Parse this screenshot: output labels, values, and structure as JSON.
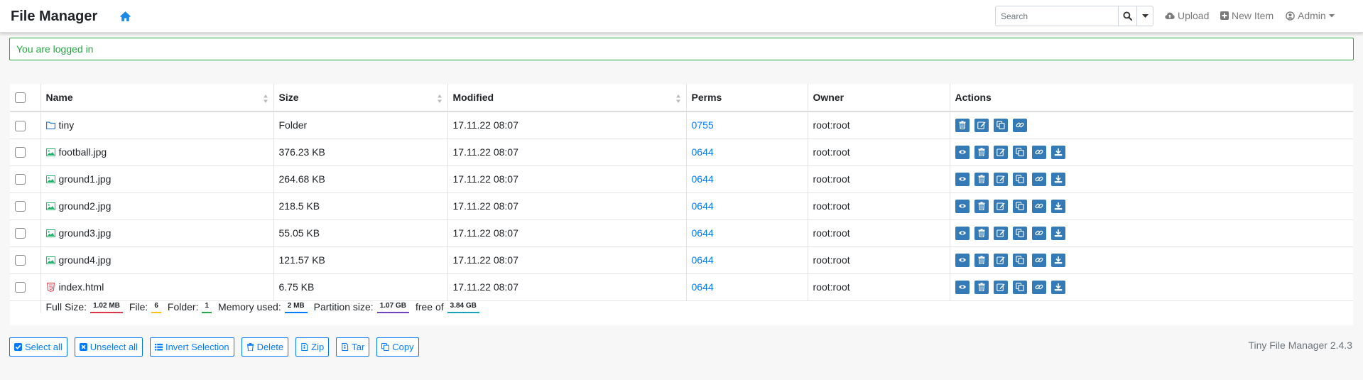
{
  "app": {
    "title": "File Manager",
    "version": "Tiny File Manager 2.4.3"
  },
  "nav": {
    "search_placeholder": "Search",
    "upload_label": "Upload",
    "new_item_label": "New Item",
    "admin_label": "Admin"
  },
  "alert": {
    "message": "You are logged in"
  },
  "table": {
    "headers": {
      "name": "Name",
      "size": "Size",
      "modified": "Modified",
      "perms": "Perms",
      "owner": "Owner",
      "actions": "Actions"
    },
    "rows": [
      {
        "name": "tiny",
        "type": "folder",
        "size": "Folder",
        "modified": "17.11.22 08:07",
        "perms": "0755",
        "owner": "root:root"
      },
      {
        "name": "football.jpg",
        "type": "image",
        "size": "376.23 KB",
        "modified": "17.11.22 08:07",
        "perms": "0644",
        "owner": "root:root"
      },
      {
        "name": "ground1.jpg",
        "type": "image",
        "size": "264.68 KB",
        "modified": "17.11.22 08:07",
        "perms": "0644",
        "owner": "root:root"
      },
      {
        "name": "ground2.jpg",
        "type": "image",
        "size": "218.5 KB",
        "modified": "17.11.22 08:07",
        "perms": "0644",
        "owner": "root:root"
      },
      {
        "name": "ground3.jpg",
        "type": "image",
        "size": "55.05 KB",
        "modified": "17.11.22 08:07",
        "perms": "0644",
        "owner": "root:root"
      },
      {
        "name": "ground4.jpg",
        "type": "image",
        "size": "121.57 KB",
        "modified": "17.11.22 08:07",
        "perms": "0644",
        "owner": "root:root"
      },
      {
        "name": "index.html",
        "type": "html",
        "size": "6.75 KB",
        "modified": "17.11.22 08:07",
        "perms": "0644",
        "owner": "root:root"
      }
    ]
  },
  "summary": {
    "full_size_label": "Full Size:",
    "full_size": "1.02 MB",
    "file_label": "File:",
    "file_count": "6",
    "folder_label": "Folder:",
    "folder_count": "1",
    "memory_label": "Memory used:",
    "memory": "2 MB",
    "partition_label": "Partition size:",
    "partition": "1.07 GB",
    "free_label": "free of",
    "free": "3.84 GB"
  },
  "buttons": {
    "select_all": "Select all",
    "unselect_all": "Unselect all",
    "invert_selection": "Invert Selection",
    "delete": "Delete",
    "zip": "Zip",
    "tar": "Tar",
    "copy": "Copy"
  },
  "colors": {
    "accent": "#007bff",
    "action_button": "#337ab7",
    "success": "#28a745",
    "full_size_bar": "#dc3545",
    "file_bar": "#ffc107",
    "folder_bar": "#28a745",
    "memory_bar": "#007bff",
    "partition_bar": "#6f42c1",
    "free_bar": "#17a2b8"
  }
}
